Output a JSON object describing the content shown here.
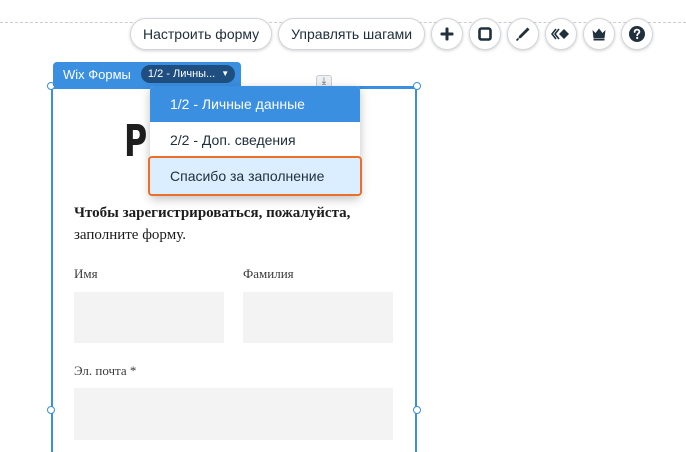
{
  "toolbar": {
    "customize_form_label": "Настроить форму",
    "manage_steps_label": "Управлять шагами",
    "icons": [
      "plus-icon",
      "square-icon",
      "pen-icon",
      "animation-icon",
      "crown-icon",
      "help-icon"
    ]
  },
  "component": {
    "name": "Wix Формы",
    "step_selector_value": "1/2 - Личны..."
  },
  "steps_dropdown": {
    "items": [
      {
        "label": "1/2 - Личные данные",
        "state": "selected"
      },
      {
        "label": "2/2 - Доп. сведения",
        "state": "normal"
      },
      {
        "label": "Спасибо за заполнение",
        "state": "hovered"
      }
    ]
  },
  "form": {
    "title_fragment": "Р",
    "intro_bold": "Чтобы зарегистрироваться, пожалуйста,",
    "intro_regular": "заполните форму.",
    "fields": {
      "first_name_label": "Имя",
      "last_name_label": "Фамилия",
      "email_label": "Эл. почта *"
    }
  },
  "colors": {
    "selection_blue": "#3a8fe0",
    "selector_dark": "#1f4f80",
    "hover_outline": "#e8702a",
    "field_bg": "#f3f3f3"
  }
}
